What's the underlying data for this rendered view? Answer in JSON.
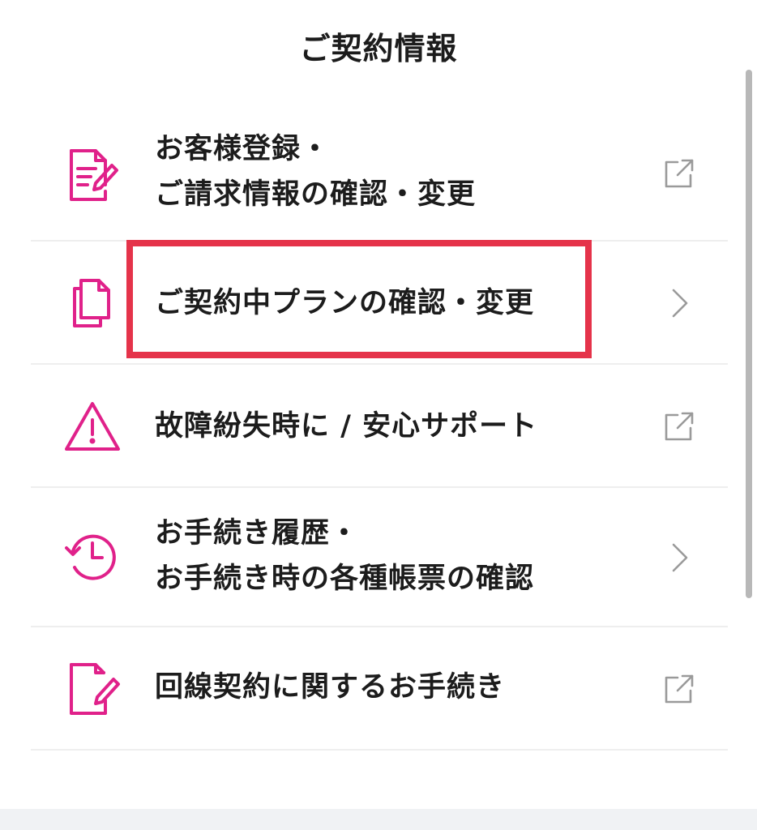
{
  "header": {
    "title": "ご契約情報"
  },
  "menu": {
    "items": [
      {
        "label": "お客様登録・\nご請求情報の確認・変更",
        "icon": "document-edit-icon",
        "trailing": "external-link-icon"
      },
      {
        "label": "ご契約中プランの確認・変更",
        "icon": "copy-documents-icon",
        "trailing": "chevron-right-icon",
        "highlighted": true
      },
      {
        "label": "故障紛失時に / 安心サポート",
        "icon": "warning-triangle-icon",
        "trailing": "external-link-icon"
      },
      {
        "label": "お手続き履歴・\nお手続き時の各種帳票の確認",
        "icon": "history-clock-icon",
        "trailing": "chevron-right-icon"
      },
      {
        "label": "回線契約に関するお手続き",
        "icon": "document-pen-icon",
        "trailing": "external-link-icon"
      }
    ]
  },
  "colors": {
    "accent": "#e0218a",
    "highlight_border": "#e5334a",
    "text": "#1c1c1c",
    "divider": "#eeeeee",
    "trailing_icon": "#9a9a9a"
  }
}
